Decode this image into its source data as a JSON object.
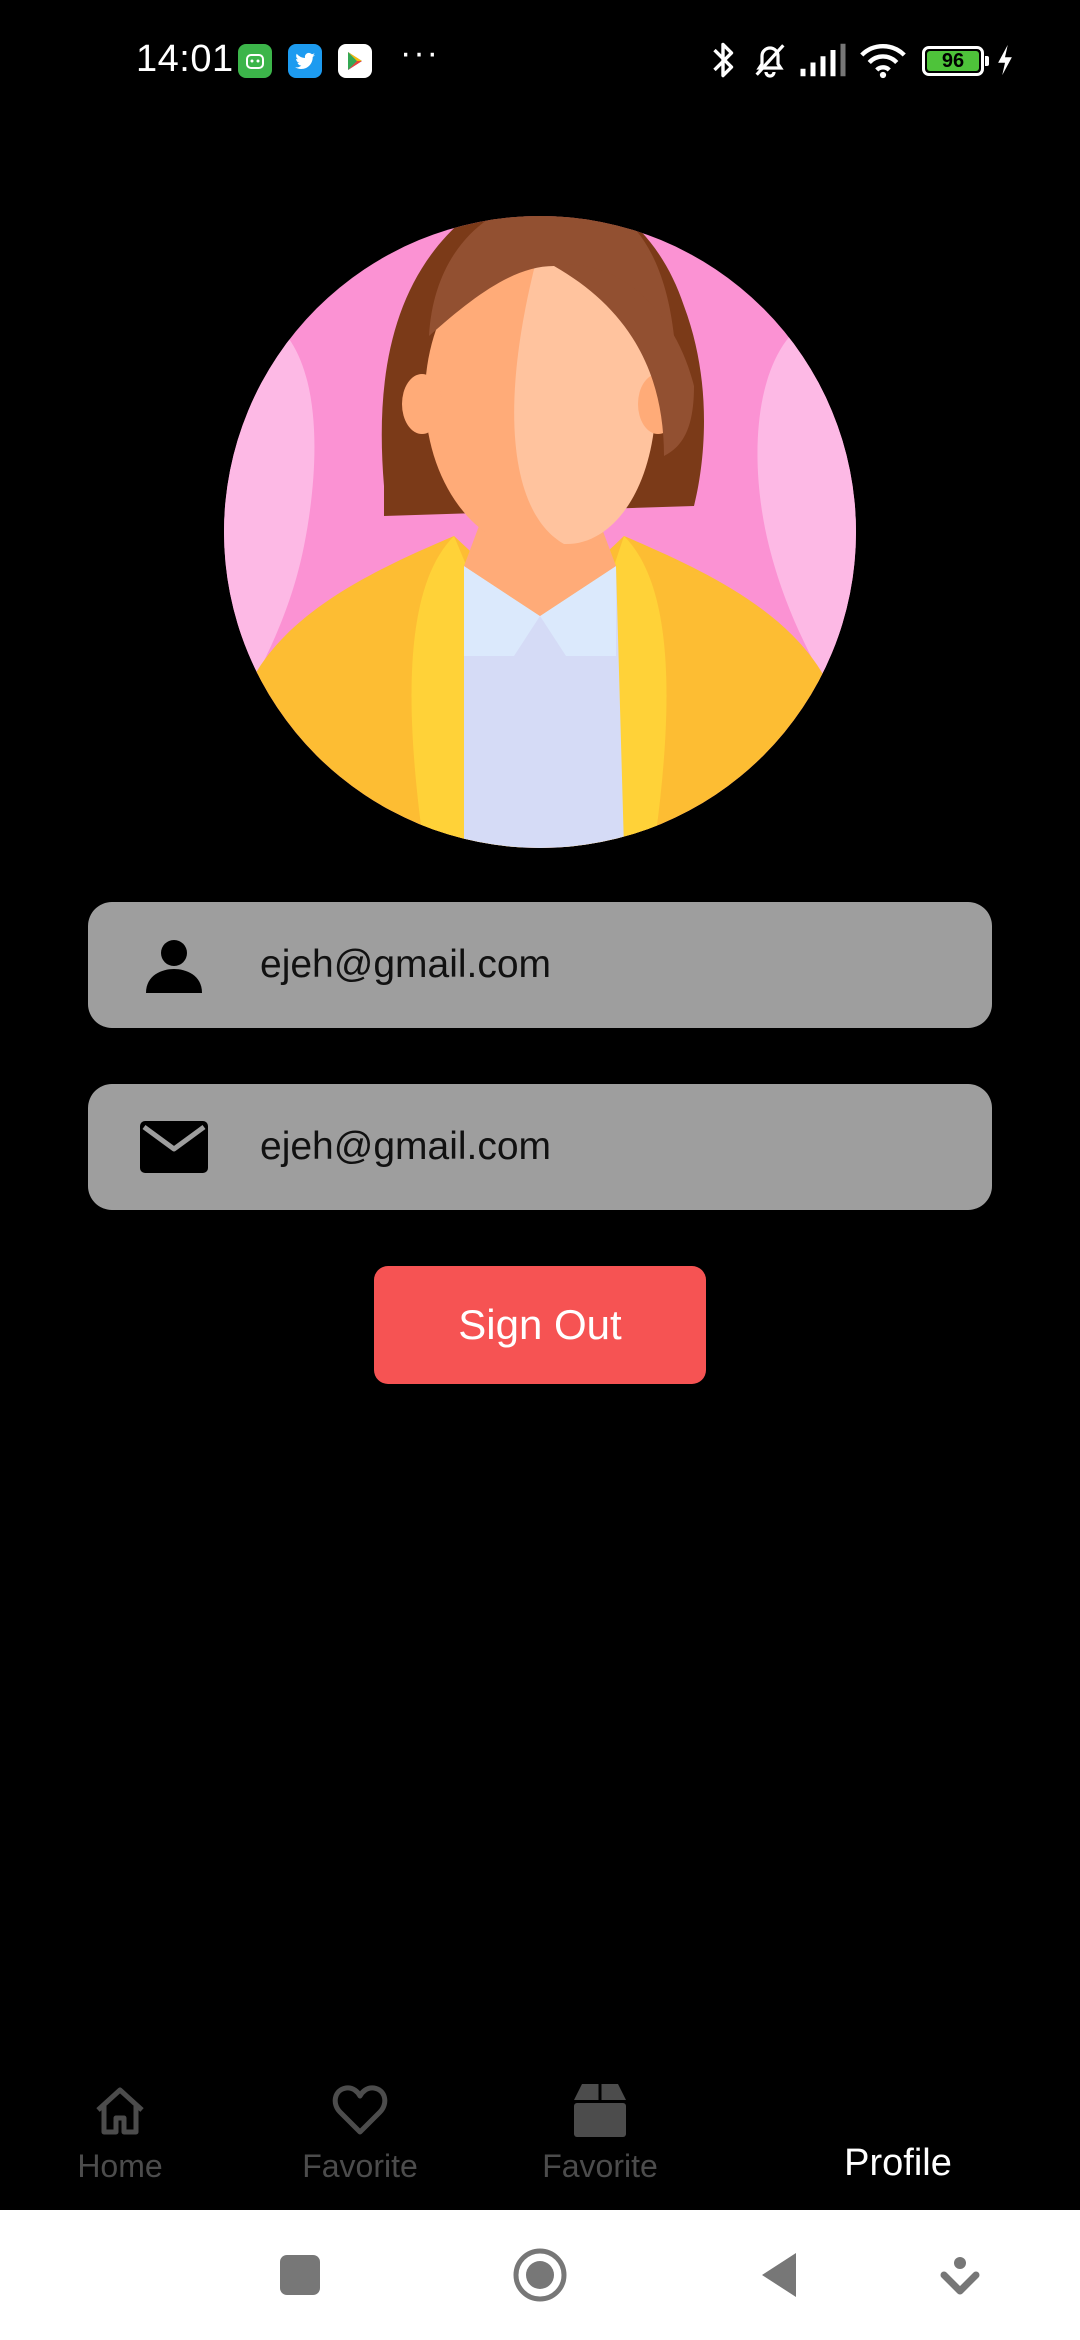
{
  "status_bar": {
    "time": "14:01",
    "notification_icons": [
      "robot-app-icon",
      "twitter-icon",
      "play-store-icon"
    ],
    "more": "···",
    "battery_level": "96",
    "icons": [
      "bluetooth-icon",
      "mute-icon",
      "signal-icon",
      "wifi-icon",
      "battery-icon",
      "charging-icon"
    ]
  },
  "profile": {
    "avatar": "woman-avatar",
    "name_value": "ejeh@gmail.com",
    "email_value": "ejeh@gmail.com",
    "sign_out_label": "Sign Out"
  },
  "bottom_nav": {
    "items": [
      {
        "label": "Home",
        "icon": "home-icon",
        "active": false
      },
      {
        "label": "Favorite",
        "icon": "heart-icon",
        "active": false
      },
      {
        "label": "Favorite",
        "icon": "box-icon",
        "active": false
      },
      {
        "label": "Profile",
        "icon": "",
        "active": true
      }
    ]
  },
  "system_nav": {
    "buttons": [
      "recents-button",
      "home-button",
      "back-button",
      "menu-button"
    ]
  },
  "colors": {
    "background": "#000000",
    "field": "#9e9e9e",
    "sign_out": "#f65353",
    "nav_inactive": "#4c4c4c",
    "nav_active": "#ffffff"
  }
}
